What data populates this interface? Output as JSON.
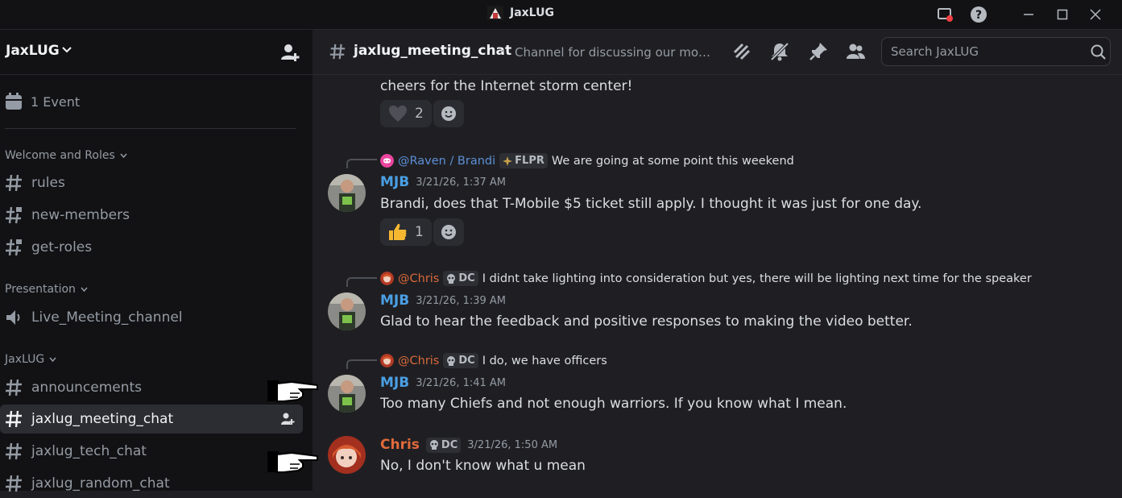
{
  "window": {
    "title": "JaxLUG"
  },
  "sidebar": {
    "server_name": "JaxLUG",
    "events_label": "1 Event",
    "categories": [
      {
        "label": "Welcome and Roles"
      },
      {
        "label": "Presentation"
      },
      {
        "label": "JaxLUG"
      }
    ],
    "channels": [
      {
        "name": "rules"
      },
      {
        "name": "new-members"
      },
      {
        "name": "get-roles"
      },
      {
        "name": "Live_Meeting_channel"
      },
      {
        "name": "announcements"
      },
      {
        "name": "jaxlug_meeting_chat"
      },
      {
        "name": "jaxlug_tech_chat"
      },
      {
        "name": "jaxlug_random_chat"
      }
    ]
  },
  "channel_header": {
    "name": "jaxlug_meeting_chat",
    "topic": "Channel for discussing our monthl...",
    "search_placeholder": "Search JaxLUG"
  },
  "messages": {
    "m0": {
      "text": "cheers for the Internet storm center!",
      "reaction_count": "2"
    },
    "m1": {
      "reply_mention": "@Raven / Brandi",
      "reply_tag": "FLPR",
      "reply_text": "We are going at some point this weekend",
      "author": "MJB",
      "timestamp": "3/21/26, 1:37 AM",
      "text": "Brandi, does that T-Mobile $5 ticket still apply. I thought it was just for one day.",
      "reaction_count": "1"
    },
    "m2": {
      "reply_mention": "@Chris",
      "reply_tag": "DC",
      "reply_text": "I didnt take lighting into consideration but yes, there will be lighting next time for the speaker",
      "author": "MJB",
      "timestamp": "3/21/26, 1:39 AM",
      "text": "Glad to hear the feedback and positive responses to making the video better."
    },
    "m3": {
      "reply_mention": "@Chris",
      "reply_tag": "DC",
      "reply_text": "I do, we have officers",
      "author": "MJB",
      "timestamp": "3/21/26, 1:41 AM",
      "text": "Too many Chiefs and not enough warriors. If you know what I mean."
    },
    "m4": {
      "author": "Chris",
      "tag": "DC",
      "timestamp": "3/21/26, 1:50 AM",
      "text": "No, I don't know what u mean"
    }
  },
  "colors": {
    "accent_blue": "#4a9fe4",
    "accent_orange": "#e06a3b",
    "background": "#1f1f23",
    "sidebar_bg": "#121214"
  }
}
